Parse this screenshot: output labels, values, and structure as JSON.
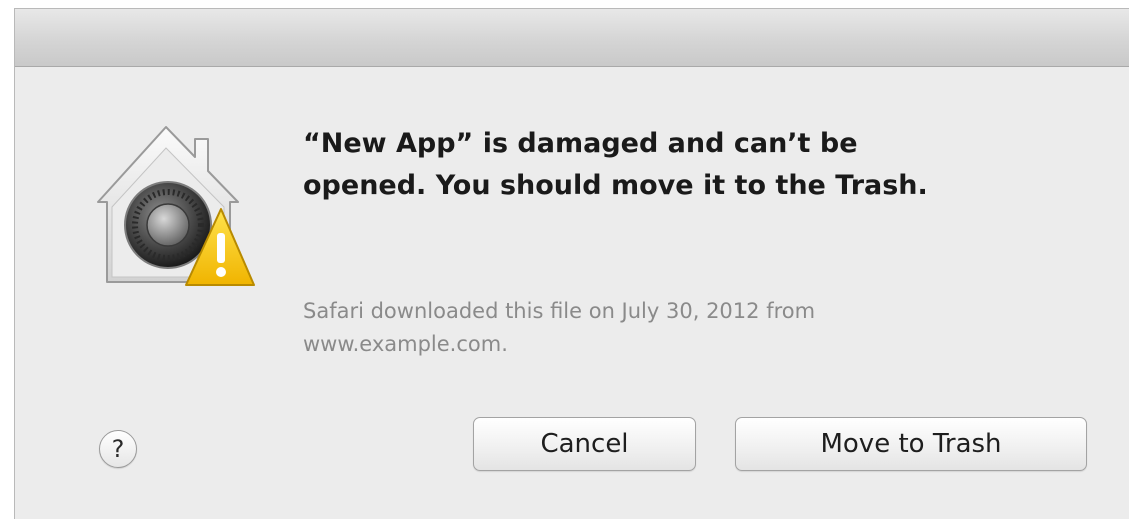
{
  "dialog": {
    "icon": "gatekeeper-warning-icon",
    "message": "“New App” is damaged and can’t be\nopened. You should move it to the Trash.",
    "informative_text": "Safari downloaded this file on July 30, 2012 from\nwww.example.com.",
    "help_label": "?",
    "cancel_label": "Cancel",
    "confirm_label": "Move to Trash"
  },
  "colors": {
    "background": "#ececec",
    "message_text": "#1a1a1a",
    "info_text": "#8a8a8a",
    "warning_yellow": "#f5c400"
  }
}
